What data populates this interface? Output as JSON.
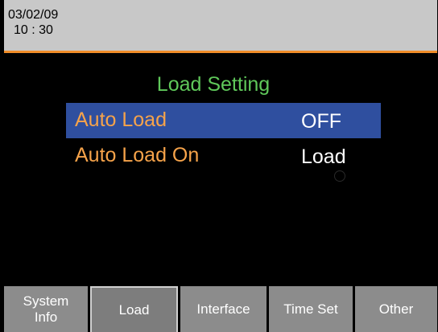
{
  "status": {
    "date": "03/02/09",
    "time": "10 : 30"
  },
  "main": {
    "title": "Load Setting",
    "rows": [
      {
        "label": "Auto Load",
        "value": "OFF",
        "selected": true
      },
      {
        "label": "Auto Load On",
        "value": "Load",
        "selected": false
      }
    ]
  },
  "softkeys": [
    {
      "line1": "System",
      "line2": "Info"
    },
    {
      "line1": "Load",
      "line2": ""
    },
    {
      "line1": "Interface",
      "line2": ""
    },
    {
      "line1": "Time Set",
      "line2": ""
    },
    {
      "line1": "Other",
      "line2": ""
    }
  ],
  "colors": {
    "title": "#5fc85a",
    "label": "#f6a34a",
    "selection": "#2f4f9f",
    "accent_border": "#f08c28",
    "softkey_bg": "#8c8c8c"
  }
}
